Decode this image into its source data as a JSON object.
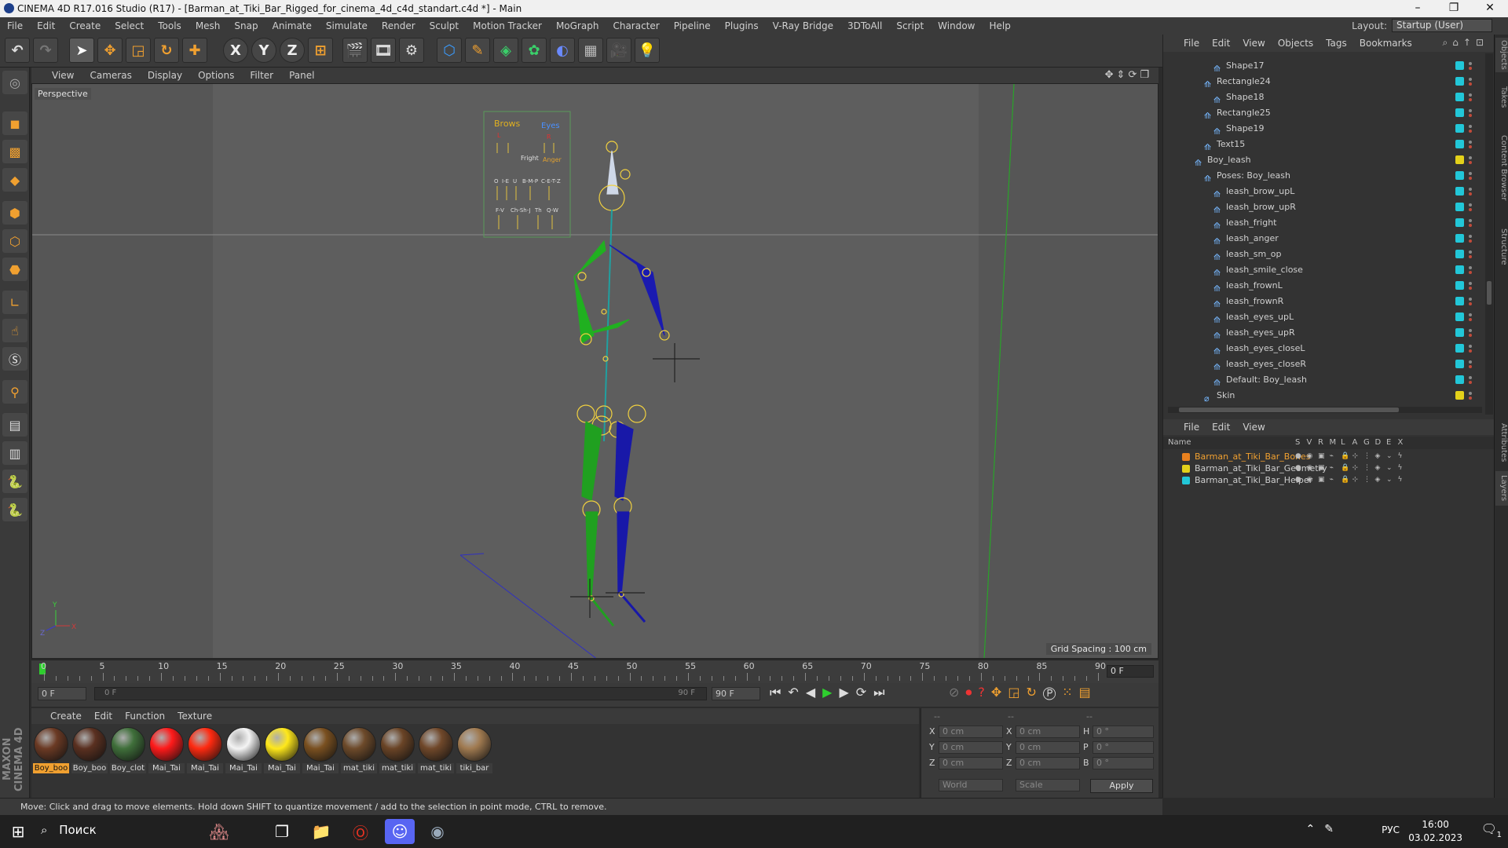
{
  "titlebar": {
    "title": "CINEMA 4D R17.016 Studio (R17) - [Barman_at_Tiki_Bar_Rigged_for_cinema_4d_c4d_standart.c4d *] - Main",
    "minimize": "–",
    "maximize": "❐",
    "close": "✕"
  },
  "menubar": {
    "items": [
      "File",
      "Edit",
      "Create",
      "Select",
      "Tools",
      "Mesh",
      "Snap",
      "Animate",
      "Simulate",
      "Render",
      "Sculpt",
      "Motion Tracker",
      "MoGraph",
      "Character",
      "Pipeline",
      "Plugins",
      "V-Ray Bridge",
      "3DToAll",
      "Script",
      "Window",
      "Help"
    ],
    "layout_label": "Layout:",
    "layout_value": "Startup (User)"
  },
  "toolbar": {
    "axis_x": "X",
    "axis_y": "Y",
    "axis_z": "Z"
  },
  "viewport": {
    "menu": [
      "View",
      "Cameras",
      "Display",
      "Options",
      "Filter",
      "Panel"
    ],
    "label": "Perspective",
    "grid_spacing": "Grid Spacing : 100 cm",
    "axis_y": "Y",
    "axis_z": "Z",
    "axis_x": "X",
    "ui_labels": [
      "Brows",
      "Eyes",
      "L",
      "R",
      "Fright",
      "Anger",
      "O",
      "I-E",
      "U",
      "B-M-P",
      "C-E-T-Z",
      "F-V",
      "Ch-Sh-J",
      "Th",
      "Q-W"
    ]
  },
  "timeline": {
    "ticks": [
      "0",
      "5",
      "10",
      "15",
      "20",
      "25",
      "30",
      "35",
      "40",
      "45",
      "50",
      "55",
      "60",
      "65",
      "70",
      "75",
      "80",
      "85",
      "90"
    ],
    "current_frame": "0 F",
    "start_field": "0 F",
    "slider_start": "0 F",
    "slider_end": "90 F",
    "end_field": "90 F"
  },
  "materials": {
    "menu": [
      "Create",
      "Edit",
      "Function",
      "Texture"
    ],
    "items": [
      {
        "label": "Boy_boo",
        "color": "#6b3a24"
      },
      {
        "label": "Boy_boo",
        "color": "#5a3020"
      },
      {
        "label": "Boy_clot",
        "color": "#3f6f3a"
      },
      {
        "label": "Mai_Tai",
        "color": "#ff1a1a"
      },
      {
        "label": "Mai_Tai",
        "color": "#ff2a10"
      },
      {
        "label": "Mai_Tai",
        "color": "#f4f4f4"
      },
      {
        "label": "Mai_Tai",
        "color": "#ffe81a"
      },
      {
        "label": "Mai_Tai",
        "color": "#7a5020"
      },
      {
        "label": "mat_tiki",
        "color": "#6d4a2a"
      },
      {
        "label": "mat_tiki",
        "color": "#6a4426"
      },
      {
        "label": "mat_tiki",
        "color": "#70482a"
      },
      {
        "label": "tiki_bar",
        "color": "#a07a50"
      }
    ]
  },
  "coords": {
    "header_a": "--",
    "header_b": "--",
    "header_c": "--",
    "rows": [
      {
        "axis": "X",
        "pos": "0 cm",
        "axis2": "X",
        "size": "0 cm",
        "rlabel": "H",
        "rot": "0 °"
      },
      {
        "axis": "Y",
        "pos": "0 cm",
        "axis2": "Y",
        "size": "0 cm",
        "rlabel": "P",
        "rot": "0 °"
      },
      {
        "axis": "Z",
        "pos": "0 cm",
        "axis2": "Z",
        "size": "0 cm",
        "rlabel": "B",
        "rot": "0 °"
      }
    ],
    "world": "World",
    "scale": "Scale",
    "apply": "Apply"
  },
  "status": {
    "text": "Move: Click and drag to move elements. Hold down SHIFT to quantize movement / add to the selection in point mode, CTRL to remove."
  },
  "objects": {
    "menu": [
      "File",
      "Edit",
      "View",
      "Objects",
      "Tags",
      "Bookmarks"
    ],
    "rows": [
      {
        "name": "Shape17",
        "indent": 3,
        "tag": "#22c7d8"
      },
      {
        "name": "Rectangle24",
        "indent": 2,
        "tag": "#22c7d8"
      },
      {
        "name": "Shape18",
        "indent": 3,
        "tag": "#22c7d8"
      },
      {
        "name": "Rectangle25",
        "indent": 2,
        "tag": "#22c7d8"
      },
      {
        "name": "Shape19",
        "indent": 3,
        "tag": "#22c7d8"
      },
      {
        "name": "Text15",
        "indent": 2,
        "tag": "#22c7d8"
      },
      {
        "name": "Boy_leash",
        "indent": 1,
        "tag": "#e3d11a"
      },
      {
        "name": "Poses: Boy_leash",
        "indent": 2,
        "tag": "#22c7d8"
      },
      {
        "name": "leash_brow_upL",
        "indent": 3,
        "tag": "#22c7d8"
      },
      {
        "name": "leash_brow_upR",
        "indent": 3,
        "tag": "#22c7d8"
      },
      {
        "name": "leash_fright",
        "indent": 3,
        "tag": "#22c7d8"
      },
      {
        "name": "leash_anger",
        "indent": 3,
        "tag": "#22c7d8"
      },
      {
        "name": "leash_sm_op",
        "indent": 3,
        "tag": "#22c7d8"
      },
      {
        "name": "leash_smile_close",
        "indent": 3,
        "tag": "#22c7d8"
      },
      {
        "name": "leash_frownL",
        "indent": 3,
        "tag": "#22c7d8"
      },
      {
        "name": "leash_frownR",
        "indent": 3,
        "tag": "#22c7d8"
      },
      {
        "name": "leash_eyes_upL",
        "indent": 3,
        "tag": "#22c7d8"
      },
      {
        "name": "leash_eyes_upR",
        "indent": 3,
        "tag": "#22c7d8"
      },
      {
        "name": "leash_eyes_closeL",
        "indent": 3,
        "tag": "#22c7d8"
      },
      {
        "name": "leash_eyes_closeR",
        "indent": 3,
        "tag": "#22c7d8"
      },
      {
        "name": "Default: Boy_leash",
        "indent": 3,
        "tag": "#22c7d8"
      },
      {
        "name": "Skin",
        "indent": 2,
        "tag": "#e3d11a"
      }
    ]
  },
  "layers": {
    "menu": [
      "File",
      "Edit",
      "View"
    ],
    "header": {
      "name": "Name",
      "cols": [
        "S",
        "V",
        "R",
        "M",
        "L",
        "A",
        "G",
        "D",
        "E",
        "X"
      ]
    },
    "rows": [
      {
        "name": "Barman_at_Tiki_Bar_Bones",
        "color": "#e8801e",
        "active": true
      },
      {
        "name": "Barman_at_Tiki_Bar_Geometry",
        "color": "#e3d11a",
        "active": false
      },
      {
        "name": "Barman_at_Tiki_Bar_Helper",
        "color": "#22c7d8",
        "active": false
      }
    ]
  },
  "side_tabs": [
    "Objects",
    "Takes",
    "Content Browser",
    "Structure",
    "Attributes",
    "Layers"
  ],
  "brand": "MAXON CINEMA 4D",
  "taskbar": {
    "search": "Поиск",
    "lang": "РУС",
    "time": "16:00",
    "date": "03.02.2023",
    "notif": "1"
  }
}
